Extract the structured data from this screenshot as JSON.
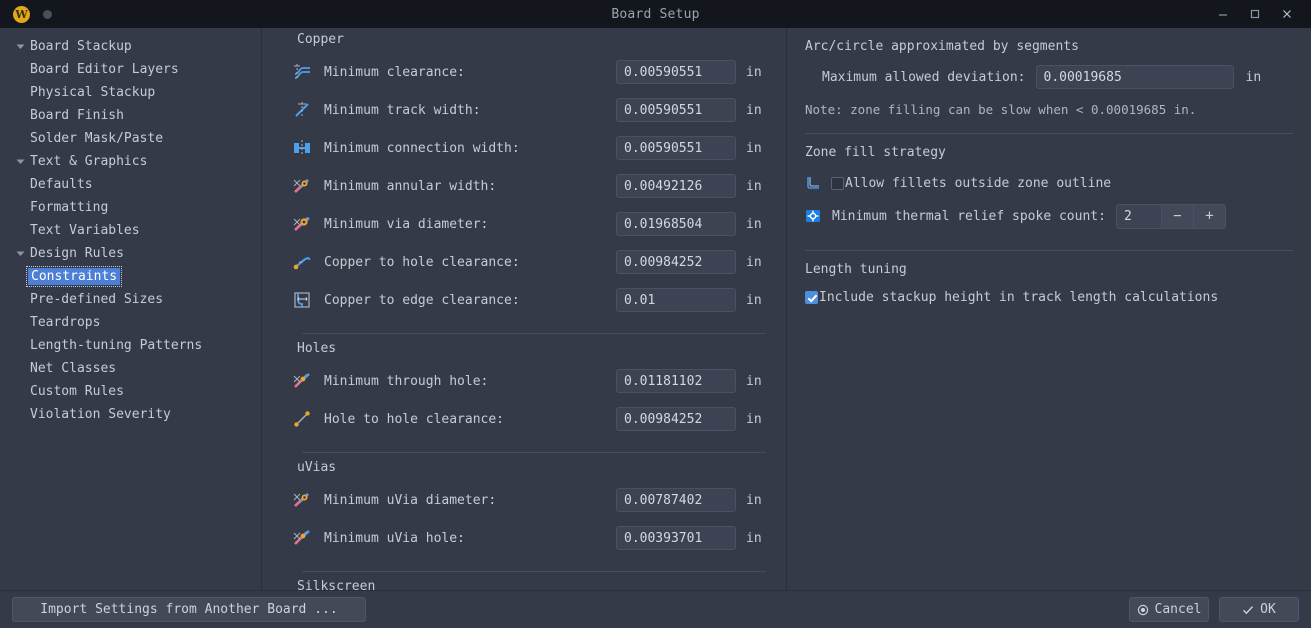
{
  "window": {
    "title": "Board Setup",
    "logo_letter": "W",
    "minimize_icon": "minimize-icon",
    "maximize_icon": "maximize-icon",
    "close_icon": "close-icon"
  },
  "sidebar": {
    "items": [
      {
        "label": "Board Stackup",
        "level": 0,
        "expanded": true,
        "selected": false
      },
      {
        "label": "Board Editor Layers",
        "level": 1,
        "expanded": false,
        "selected": false
      },
      {
        "label": "Physical Stackup",
        "level": 1,
        "expanded": false,
        "selected": false
      },
      {
        "label": "Board Finish",
        "level": 1,
        "expanded": false,
        "selected": false
      },
      {
        "label": "Solder Mask/Paste",
        "level": 1,
        "expanded": false,
        "selected": false
      },
      {
        "label": "Text & Graphics",
        "level": 0,
        "expanded": true,
        "selected": false
      },
      {
        "label": "Defaults",
        "level": 1,
        "expanded": false,
        "selected": false
      },
      {
        "label": "Formatting",
        "level": 1,
        "expanded": false,
        "selected": false
      },
      {
        "label": "Text Variables",
        "level": 1,
        "expanded": false,
        "selected": false
      },
      {
        "label": "Design Rules",
        "level": 0,
        "expanded": true,
        "selected": false
      },
      {
        "label": "Constraints",
        "level": 1,
        "expanded": false,
        "selected": true
      },
      {
        "label": "Pre-defined Sizes",
        "level": 1,
        "expanded": false,
        "selected": false
      },
      {
        "label": "Teardrops",
        "level": 1,
        "expanded": false,
        "selected": false
      },
      {
        "label": "Length-tuning Patterns",
        "level": 1,
        "expanded": false,
        "selected": false
      },
      {
        "label": "Net Classes",
        "level": 1,
        "expanded": false,
        "selected": false
      },
      {
        "label": "Custom Rules",
        "level": 1,
        "expanded": false,
        "selected": false
      },
      {
        "label": "Violation Severity",
        "level": 1,
        "expanded": false,
        "selected": false
      }
    ]
  },
  "constraints": {
    "sections": [
      {
        "title": "Copper",
        "divider": false,
        "fields": [
          {
            "icon": "min-clearance-icon",
            "label": "Minimum clearance:",
            "value": "0.00590551",
            "unit": "in"
          },
          {
            "icon": "min-track-width-icon",
            "label": "Minimum track width:",
            "value": "0.00590551",
            "unit": "in"
          },
          {
            "icon": "min-connection-width-icon",
            "label": "Minimum connection width:",
            "value": "0.00590551",
            "unit": "in"
          },
          {
            "icon": "min-annular-width-icon",
            "label": "Minimum annular width:",
            "value": "0.00492126",
            "unit": "in"
          },
          {
            "icon": "min-via-diameter-icon",
            "label": "Minimum via diameter:",
            "value": "0.01968504",
            "unit": "in"
          },
          {
            "icon": "copper-to-hole-icon",
            "label": "Copper to hole clearance:",
            "value": "0.00984252",
            "unit": "in"
          },
          {
            "icon": "copper-to-edge-icon",
            "label": "Copper to edge clearance:",
            "value": "0.01",
            "unit": "in"
          }
        ]
      },
      {
        "title": "Holes",
        "divider": true,
        "fields": [
          {
            "icon": "min-through-hole-icon",
            "label": "Minimum through hole:",
            "value": "0.01181102",
            "unit": "in"
          },
          {
            "icon": "hole-to-hole-icon",
            "label": "Hole to hole clearance:",
            "value": "0.00984252",
            "unit": "in"
          }
        ]
      },
      {
        "title": "uVias",
        "divider": true,
        "fields": [
          {
            "icon": "min-uvia-diameter-icon",
            "label": "Minimum uVia diameter:",
            "value": "0.00787402",
            "unit": "in"
          },
          {
            "icon": "min-uvia-hole-icon",
            "label": "Minimum uVia hole:",
            "value": "0.00393701",
            "unit": "in"
          }
        ]
      },
      {
        "title": "Silkscreen",
        "divider": true,
        "fields": []
      }
    ]
  },
  "right_panel": {
    "arc": {
      "title": "Arc/circle approximated by segments",
      "deviation_label": "Maximum allowed deviation:",
      "deviation_value": "0.00019685",
      "deviation_unit": "in",
      "note": "Note: zone filling can be slow when < 0.00019685 in."
    },
    "zone_fill": {
      "title": "Zone fill strategy",
      "fillets_icon": "zone-fillet-icon",
      "fillets_label": "Allow fillets outside zone outline",
      "fillets_checked": false,
      "spoke_icon": "thermal-spoke-icon",
      "spoke_label": "Minimum thermal relief spoke count:",
      "spoke_value": "2",
      "spoke_minus": "−",
      "spoke_plus": "+"
    },
    "length_tuning": {
      "title": "Length tuning",
      "stackup_label": "Include stackup height in track length calculations",
      "stackup_checked": true
    }
  },
  "footer": {
    "import_label": "Import Settings from Another Board ...",
    "cancel_label": "Cancel",
    "cancel_icon": "cancel-circle-icon",
    "ok_label": "OK",
    "ok_icon": "check-icon"
  },
  "colors": {
    "window_bg": "#353a48",
    "titlebar_bg": "#14161d",
    "accent_blue": "#4d7fd4",
    "checkbox_checked": "#4d8fe0",
    "input_bg": "#3e4354",
    "logo_gold": "#e0a81c"
  }
}
